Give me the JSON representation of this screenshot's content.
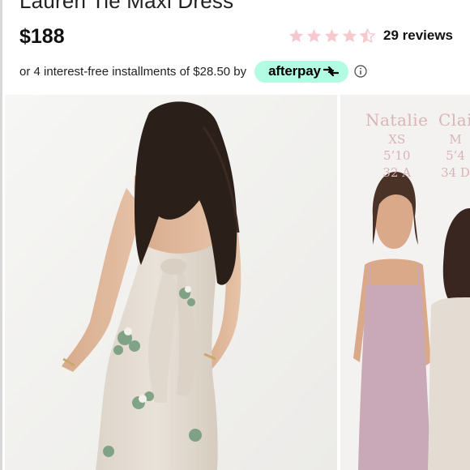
{
  "product": {
    "title": "Lauren Tie Maxi Dress",
    "price": "$188"
  },
  "rating": {
    "stars": 4.5,
    "max_stars": 5,
    "star_color": "#f7c9cf",
    "reviews_label": "29 reviews"
  },
  "installments": {
    "text": "or 4 interest-free installments of $28.50 by",
    "brand": "afterpay",
    "brand_color": "#b2fce4"
  },
  "icons": {
    "info": "info-icon",
    "afterpay_arrows": "afterpay-arrows-icon"
  },
  "gallery": {
    "size_chart": [
      {
        "name": "Natalie",
        "size": "XS",
        "height": "5’10",
        "bust": "32 A"
      },
      {
        "name": "Clai",
        "size": "M",
        "height": "5’4",
        "bust": "34 D"
      }
    ]
  }
}
